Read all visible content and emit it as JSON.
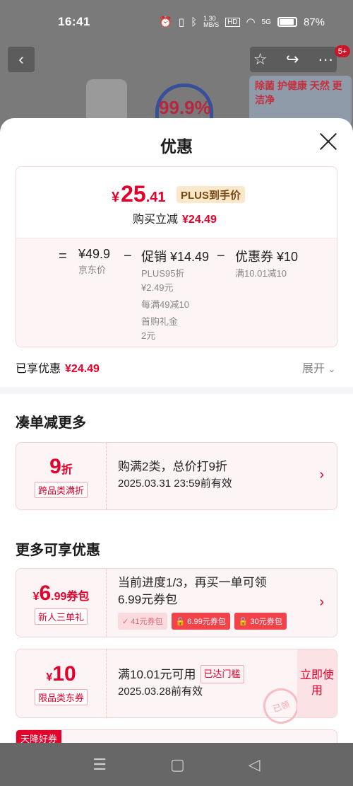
{
  "status_bar": {
    "time": "16:41",
    "net_speed": "1.30 MB/S",
    "hd": "HD",
    "signal": "5G",
    "battery": "87%"
  },
  "top_nav": {
    "cart_badge": "5+"
  },
  "product_image": {
    "label_percent": "99.9%",
    "label_text": "除菌 护健康 天然 更洁净"
  },
  "sheet": {
    "title": "优惠"
  },
  "price": {
    "yen": "¥",
    "integer": "25",
    "decimal": ".41",
    "plus_tag": "PLUS到手价",
    "reduce_label": "购买立减",
    "reduce_value": "¥24.49",
    "breakdown": {
      "eq": "=",
      "jd_price": "¥49.9",
      "jd_price_label": "京东价",
      "minus1": "−",
      "promo": "促销 ¥14.49",
      "promo_sub1": "PLUS95折",
      "promo_sub2": "¥2.49元",
      "promo_sub3": "每满49减10",
      "promo_sub4": "首购礼金",
      "promo_sub5": "2元",
      "minus2": "−",
      "coupon": "优惠券 ¥10",
      "coupon_sub": "满10.01减10"
    }
  },
  "enjoyed": {
    "label": "已享优惠",
    "value": "¥24.49",
    "expand": "展开"
  },
  "section_more_order": {
    "title": "凑单减更多",
    "card": {
      "num": "9",
      "unit": "折",
      "tag": "跨品类满折",
      "line1": "购满2类，总价打9折",
      "line2": "2025.03.31 23:59前有效"
    }
  },
  "section_more_benefits": {
    "title": "更多可享优惠",
    "newuser": {
      "yen": "¥",
      "num": "6",
      "dec": ".99",
      "unit": "券包",
      "tag": "新人三单礼",
      "line1": "当前进度1/3，再买一单可领",
      "line2": "6.99元券包",
      "chips": [
        "41元券包",
        "6.99元券包",
        "30元券包"
      ]
    },
    "coupon": {
      "yen": "¥",
      "num": "10",
      "tag": "限品类东券",
      "line1": "满10.01元可用",
      "reached": "已达门槛",
      "line2": "2025.03.28前有效",
      "button": "立即使用",
      "stamp": "已领"
    },
    "next_tag": "天降好券"
  },
  "colors": {
    "accent": "#e4002b",
    "plus_gold": "#fbe7c9"
  }
}
